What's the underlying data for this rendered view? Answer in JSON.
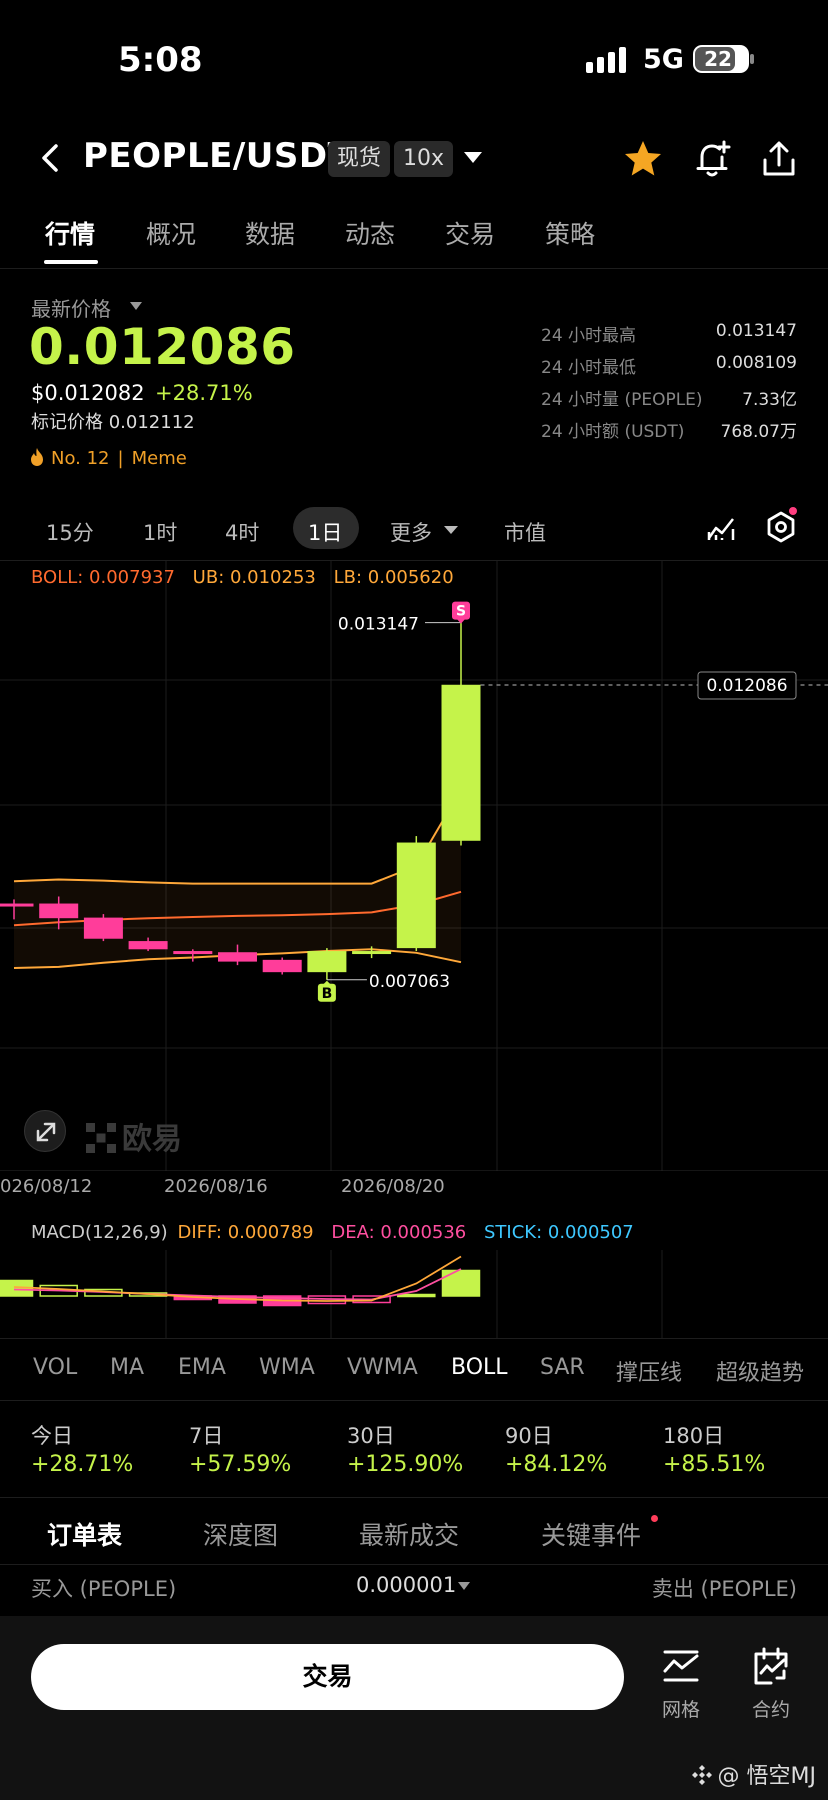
{
  "status_bar": {
    "time": "5:08",
    "network": "5G",
    "battery": "22"
  },
  "header": {
    "pair": "PEOPLE/USDT",
    "market_type": "现货",
    "leverage": "10x",
    "icons": [
      "back-icon",
      "star-icon",
      "alert-bell-icon",
      "share-icon"
    ],
    "favorite_color": "#f5a623"
  },
  "tabs": [
    "行情",
    "概况",
    "数据",
    "动态",
    "交易",
    "策略"
  ],
  "price": {
    "label": "最新价格",
    "last": "0.012086",
    "usd": "$0.012082",
    "change": "+28.71%",
    "mark": "标记价格 0.012112",
    "rank": "No. 12",
    "category": "Meme",
    "accent_color": "#c5f34a"
  },
  "stats": [
    {
      "label": "24 小时最高",
      "value": "0.013147"
    },
    {
      "label": "24 小时最低",
      "value": "0.008109"
    },
    {
      "label": "24 小时量 (PEOPLE)",
      "value": "7.33亿"
    },
    {
      "label": "24 小时额 (USDT)",
      "value": "768.07万"
    }
  ],
  "intervals": [
    "15分",
    "1时",
    "4时",
    "1日",
    "更多",
    "市值"
  ],
  "selected_interval": "1日",
  "boll_legend": {
    "boll": "BOLL: 0.007937",
    "ub": "UB: 0.010253",
    "lb": "LB: 0.005620"
  },
  "watermark": "欧易",
  "chart_data": {
    "type": "candlestick",
    "title": "",
    "x_labels": [
      "026/08/12",
      "2026/08/16",
      "2026/08/20"
    ],
    "candles": [
      {
        "open": 0.00836,
        "high": 0.00843,
        "low": 0.00809,
        "close": 0.00834
      },
      {
        "open": 0.00836,
        "high": 0.00848,
        "low": 0.00792,
        "close": 0.00811
      },
      {
        "open": 0.00812,
        "high": 0.00818,
        "low": 0.00772,
        "close": 0.00776
      },
      {
        "open": 0.00772,
        "high": 0.00778,
        "low": 0.00755,
        "close": 0.00758
      },
      {
        "open": 0.00755,
        "high": 0.00758,
        "low": 0.00737,
        "close": 0.00751
      },
      {
        "open": 0.00753,
        "high": 0.00766,
        "low": 0.00731,
        "close": 0.00737
      },
      {
        "open": 0.0074,
        "high": 0.00744,
        "low": 0.00715,
        "close": 0.00719
      },
      {
        "open": 0.00719,
        "high": 0.0076,
        "low": 0.00706,
        "close": 0.00755
      },
      {
        "open": 0.00754,
        "high": 0.00763,
        "low": 0.00743,
        "close": 0.00755
      },
      {
        "open": 0.0076,
        "high": 0.00951,
        "low": 0.00755,
        "close": 0.0094
      },
      {
        "open": 0.00943,
        "high": 0.01315,
        "low": 0.00935,
        "close": 0.01209
      }
    ],
    "boll_upper": [
      0.00874,
      0.00877,
      0.00875,
      0.00872,
      0.0087,
      0.0087,
      0.0087,
      0.0087,
      0.0087,
      0.009,
      0.0103
    ],
    "boll_mid": [
      0.00799,
      0.00804,
      0.00808,
      0.00811,
      0.00813,
      0.00815,
      0.00816,
      0.00818,
      0.00821,
      0.00834,
      0.00856
    ],
    "boll_lower": [
      0.00726,
      0.00728,
      0.00735,
      0.00741,
      0.00744,
      0.00748,
      0.00751,
      0.00755,
      0.00758,
      0.00752,
      0.00736
    ],
    "high_marker": "0.013147",
    "low_marker": "0.007063",
    "last_price_label": "0.012086",
    "sell_marker": "S",
    "buy_marker": "B",
    "up_color": "#c5f34a",
    "down_color": "#ff3d9a",
    "y_range": [
      0.0038,
      0.0142
    ]
  },
  "macd": {
    "legend": {
      "name": "MACD(12,26,9)",
      "diff": "DIFF: 0.000789",
      "dea": "DEA: 0.000536",
      "stick": "STICK: 0.000507"
    },
    "sticks": [
      0.00031,
      0.00021,
      0.00013,
      6e-05,
      -7e-05,
      -0.00014,
      -0.00019,
      -0.00015,
      -0.00013,
      3e-05,
      0.00051
    ],
    "diff": [
      0.00018,
      0.00014,
      9e-05,
      4e-05,
      -2e-05,
      -6e-05,
      -9e-05,
      -0.0001,
      -9e-05,
      0.00025,
      0.00079
    ],
    "dea": [
      0.00013,
      0.00011,
      8e-05,
      4e-05,
      1e-05,
      -2e-05,
      -4e-05,
      -6e-05,
      -7e-05,
      0.0001,
      0.00054
    ]
  },
  "indicators": [
    "VOL",
    "MA",
    "EMA",
    "WMA",
    "VWMA",
    "BOLL",
    "SAR",
    "撑压线",
    "超级趋势"
  ],
  "active_indicator": "BOLL",
  "performance": [
    {
      "label": "今日",
      "value": "+28.71%"
    },
    {
      "label": "7日",
      "value": "+57.59%"
    },
    {
      "label": "30日",
      "value": "+125.90%"
    },
    {
      "label": "90日",
      "value": "+84.12%"
    },
    {
      "label": "180日",
      "value": "+85.51%"
    }
  ],
  "bottom_tabs": [
    "订单表",
    "深度图",
    "最新成交",
    "关键事件"
  ],
  "orderbook": {
    "buy": "买入 (PEOPLE)",
    "precision": "0.000001",
    "sell": "卖出 (PEOPLE)"
  },
  "bottom_bar": {
    "trade": "交易",
    "grid": "网格",
    "futures": "合约"
  },
  "credit": "@ 悟空MJ"
}
